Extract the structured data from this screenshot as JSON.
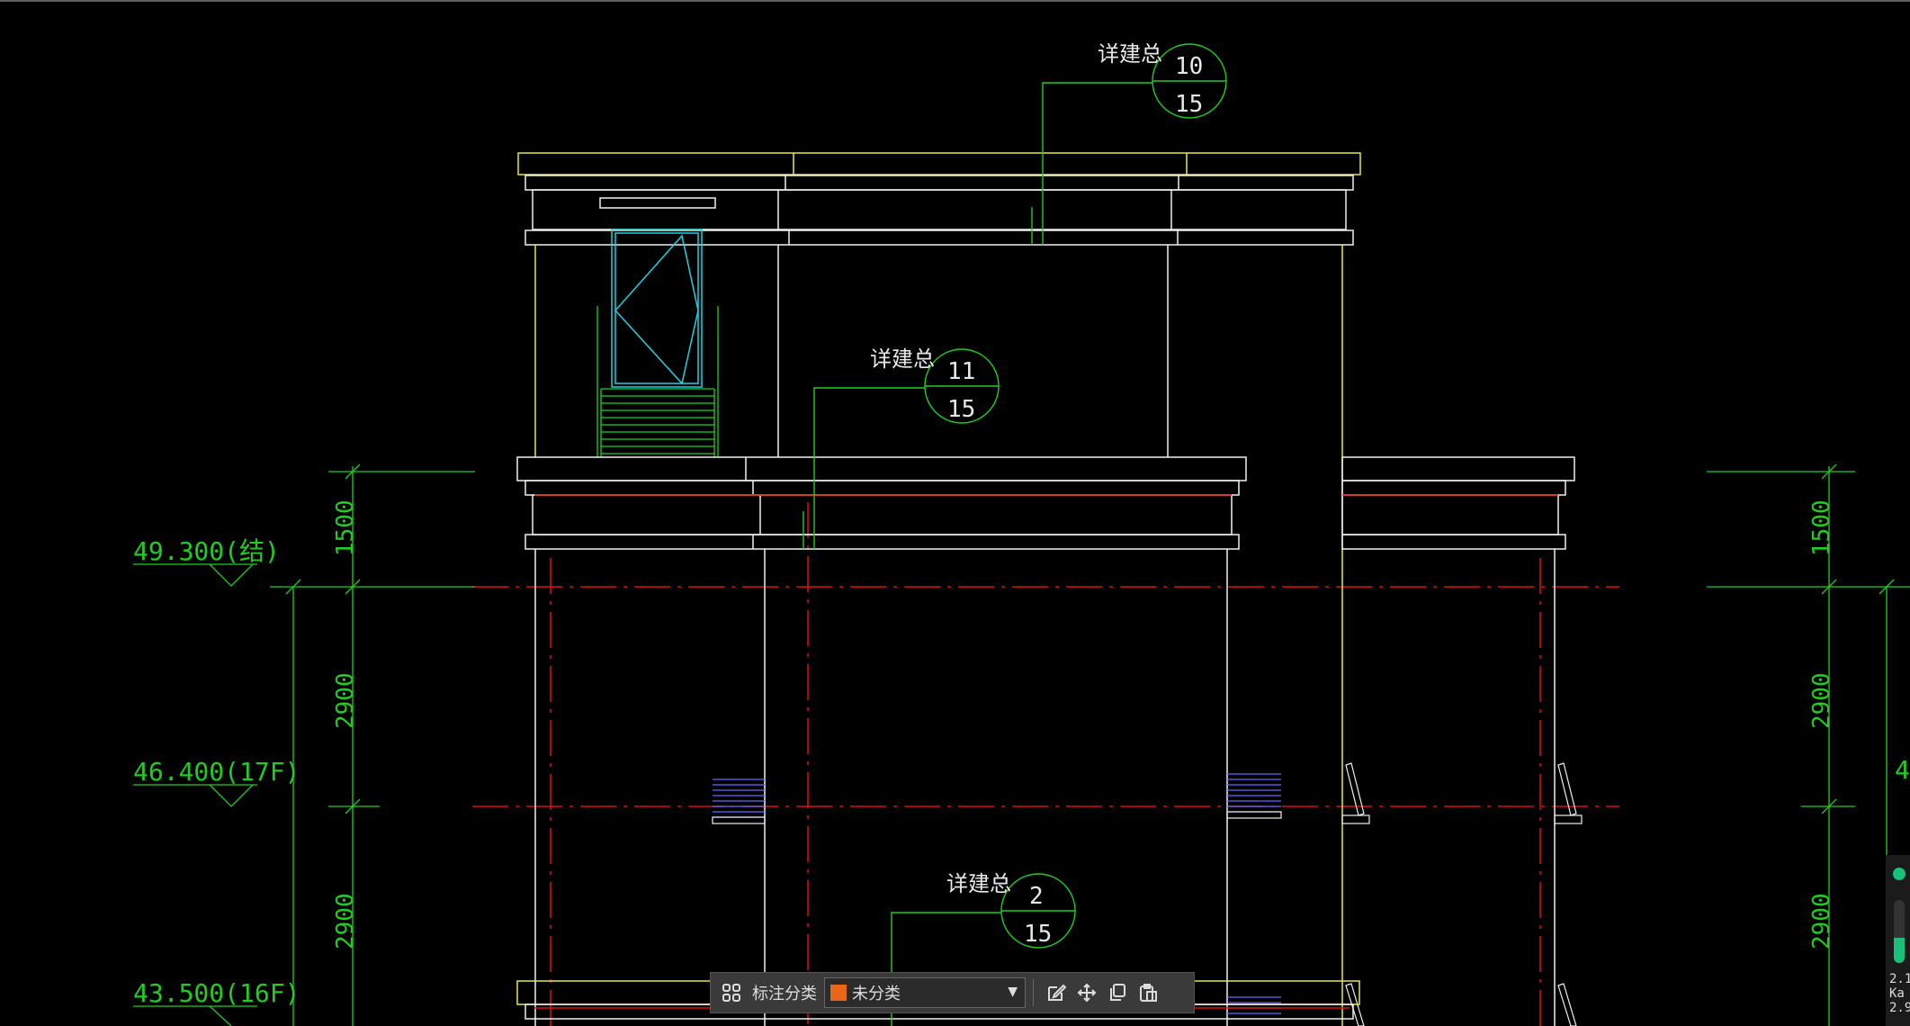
{
  "drawing": {
    "level_marks": [
      {
        "value": "49.300(结)"
      },
      {
        "value": "46.400(17F)"
      },
      {
        "value": "43.500(16F)"
      }
    ],
    "dimensions": [
      "1500",
      "2900",
      "2900",
      "1500",
      "2900",
      "2900"
    ],
    "detail_callouts": [
      {
        "title": "详建总",
        "top": "10",
        "bottom": "15"
      },
      {
        "title": "详建总",
        "top": "11",
        "bottom": "15"
      },
      {
        "title": "详建总",
        "top": "2",
        "bottom": "15"
      }
    ],
    "partial_text_right": "4"
  },
  "colors": {
    "background": "#000000",
    "building_lines": "#e8e840",
    "white_lines": "#f0f0f0",
    "dimension_lines": "#22cc22",
    "axis_lines": "#dd1111",
    "window_cyan": "#22d0e0",
    "railing_blue": "#6666ff",
    "toolbar_bg": "#3a3a3a",
    "swatch": "#e8661a"
  },
  "toolbar": {
    "layout_icon": "grid-icon",
    "label": "标注分类",
    "category_value": "未分类",
    "edit_icon": "edit-icon",
    "move_icon": "move-icon",
    "copy_icon": "copy-icon",
    "paste_icon": "paste-icon"
  },
  "side_widget": {
    "ann1": "2.1",
    "ann2": "Ka",
    "ann3": "2.9"
  }
}
